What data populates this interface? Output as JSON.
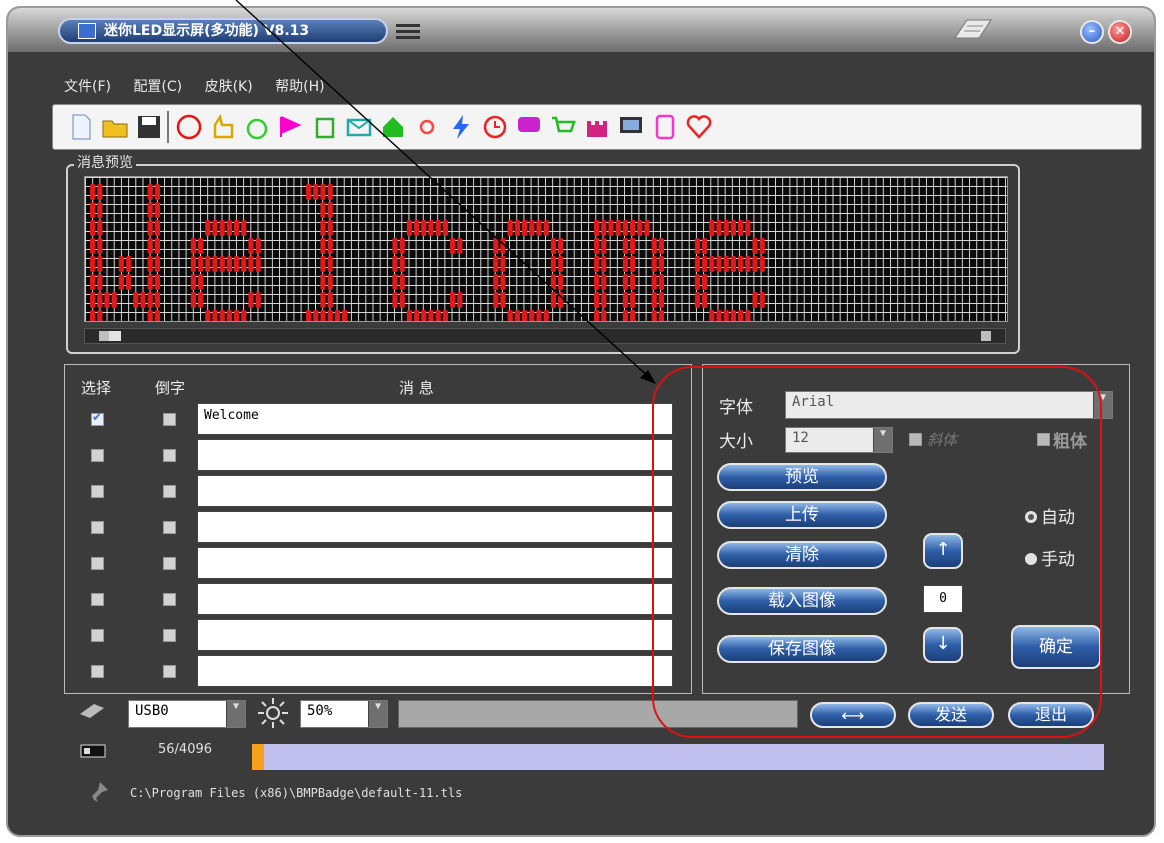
{
  "window": {
    "title": "迷你LED显示屏(多功能) V8.13"
  },
  "menu": [
    "文件(F)",
    "配置(C)",
    "皮肤(K)",
    "帮助(H)"
  ],
  "toolbar_icons": [
    "new-file-icon",
    "open-folder-icon",
    "save-icon",
    "smiley-icon",
    "hand-icon",
    "apple-icon",
    "flag-icon",
    "trash-icon",
    "mail-icon",
    "house-icon",
    "sun-icon",
    "lightning-icon",
    "clock-icon",
    "chat-icon",
    "cart-icon",
    "castle-icon",
    "monitor-icon",
    "ipod-icon",
    "heart-icon"
  ],
  "preview": {
    "label": "消息预览",
    "text": "Welcome",
    "led_color": "#e01a1a"
  },
  "list": {
    "headers": {
      "select": "选择",
      "invert": "倒字",
      "message": "消 息"
    },
    "rows": [
      {
        "selected": true,
        "inverted": false,
        "text": "Welcome"
      },
      {
        "selected": false,
        "inverted": false,
        "text": ""
      },
      {
        "selected": false,
        "inverted": false,
        "text": ""
      },
      {
        "selected": false,
        "inverted": false,
        "text": ""
      },
      {
        "selected": false,
        "inverted": false,
        "text": ""
      },
      {
        "selected": false,
        "inverted": false,
        "text": ""
      },
      {
        "selected": false,
        "inverted": false,
        "text": ""
      },
      {
        "selected": false,
        "inverted": false,
        "text": ""
      }
    ]
  },
  "controls": {
    "font_label": "字体",
    "font_value": "Arial",
    "size_label": "大小",
    "size_value": "12",
    "italic_label": "斜体",
    "bold_label": "粗体",
    "preview_btn": "预览",
    "upload_btn": "上传",
    "clear_btn": "清除",
    "load_image_btn": "载入图像",
    "save_image_btn": "保存图像",
    "auto_label": "自动",
    "manual_label": "手动",
    "counter_value": "0",
    "confirm_btn": "确定",
    "up_arrow": "↑",
    "down_arrow": "↓"
  },
  "bottom": {
    "port_value": "USB0",
    "brightness_value": "50%",
    "send_btn": "发送",
    "exit_btn": "退出",
    "usage_text": "56/4096",
    "usage_fraction": 0.0137,
    "path_text": "C:\\Program Files (x86)\\BMPBadge\\default-11.tls"
  },
  "colors": {
    "accent_blue": "#2e5ea8",
    "led_red": "#e01a1a",
    "annotation_red": "#d11111",
    "progress_bg": "#c2c0ef",
    "progress_fill": "#f5a11a"
  }
}
